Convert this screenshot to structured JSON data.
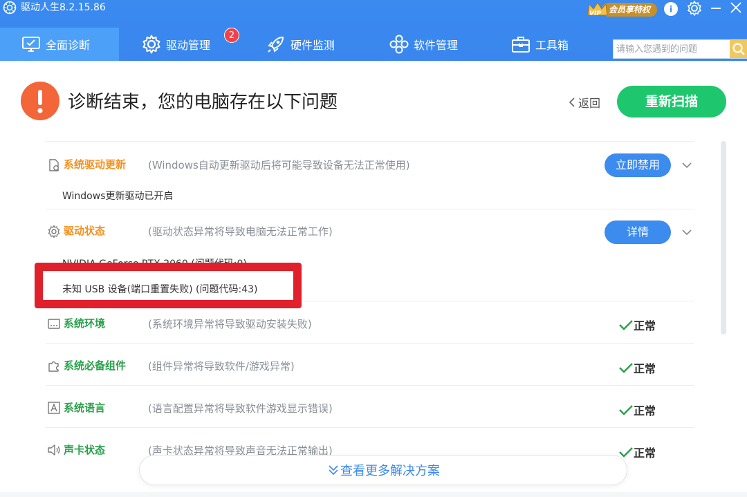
{
  "app": {
    "title": "驱动人生8.2.15.86",
    "vip_text": "会员享特权",
    "vip_label": "VIP"
  },
  "nav": {
    "items": [
      {
        "label": "全面诊断",
        "icon": "monitor-check-icon",
        "active": true
      },
      {
        "label": "驱动管理",
        "icon": "gear-icon",
        "badge": "2"
      },
      {
        "label": "硬件监测",
        "icon": "rocket-icon"
      },
      {
        "label": "软件管理",
        "icon": "apps-icon"
      },
      {
        "label": "工具箱",
        "icon": "toolbox-icon"
      }
    ],
    "search_placeholder": "请输入您遇到的问题"
  },
  "header": {
    "title": "诊断结束，您的电脑存在以下问题",
    "back_label": "返回",
    "rescan_label": "重新扫描"
  },
  "items": [
    {
      "title": "系统驱动更新",
      "desc": "(Windows自动更新驱动后将可能导致设备无法正常使用)",
      "status": "problem",
      "action": "立即禁用",
      "details": [
        "Windows更新驱动已开启"
      ],
      "icon": "document-icon"
    },
    {
      "title": "驱动状态",
      "desc": "(驱动状态异常将导致电脑无法正常工作)",
      "status": "problem",
      "action": "详情",
      "details": [
        "NVIDIA GeForce RTX 2060 (问题代码:0)",
        "未知 USB 设备(端口重置失败) (问题代码:43)"
      ],
      "icon": "gear-icon"
    },
    {
      "title": "系统环境",
      "desc": "(系统环境异常将导致驱动安装失败)",
      "status": "ok",
      "ok_label": "正常",
      "icon": "window-icon"
    },
    {
      "title": "系统必备组件",
      "desc": "(组件异常将导致软件/游戏异常)",
      "status": "ok",
      "ok_label": "正常",
      "icon": "puzzle-icon"
    },
    {
      "title": "系统语言",
      "desc": "(语言配置异常将导致软件游戏显示错误)",
      "status": "ok",
      "ok_label": "正常",
      "icon": "language-icon"
    },
    {
      "title": "声卡状态",
      "desc": "(声卡状态异常将导致声音无法正常输出)",
      "status": "ok",
      "ok_label": "正常",
      "icon": "speaker-icon"
    }
  ],
  "footer": {
    "more_label": "查看更多解决方案"
  },
  "colors": {
    "brand_blue": "#3a8af0",
    "accent_green": "#1ec76d",
    "warning_orange": "#f5901d",
    "ok_green": "#28a04a",
    "highlight_red": "#e0202a"
  }
}
